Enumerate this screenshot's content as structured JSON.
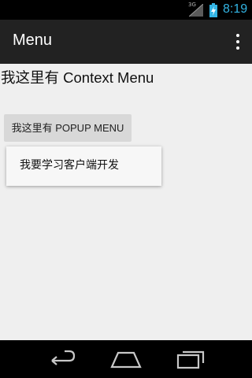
{
  "status_bar": {
    "network": "3G",
    "time": "8:19"
  },
  "action_bar": {
    "title": "Menu",
    "overflow_icon": "more-vert-icon"
  },
  "content": {
    "context_menu_text": "我这里有 Context Menu",
    "popup_button_label": "我这里有 POPUP MENU"
  },
  "popup_menu": {
    "items": [
      {
        "label": "我要学习客户端开发"
      }
    ]
  },
  "nav_bar": {
    "icons": [
      "back-icon",
      "home-icon",
      "recent-apps-icon"
    ]
  },
  "colors": {
    "status_time": "#33b5e5",
    "action_bar_bg": "#222222",
    "content_bg": "#efefef"
  }
}
